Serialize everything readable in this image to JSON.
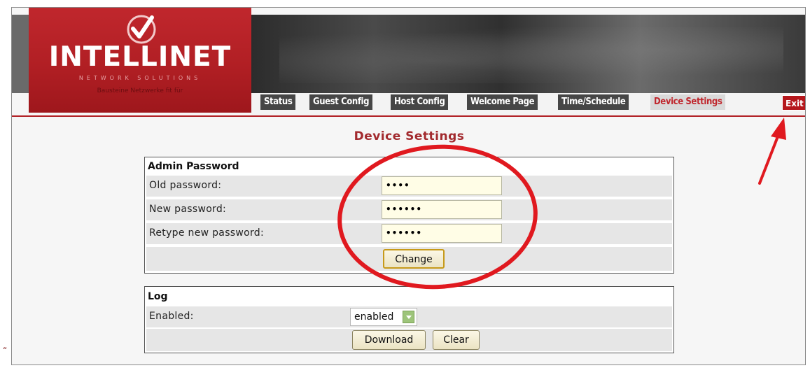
{
  "header": {
    "logo_text": "INTELLINET",
    "logo_subtitle": "NETWORK SOLUTIONS",
    "logo_tagline": "Bausteine Netzwerke fit für",
    "nav": [
      {
        "label": "Status",
        "active": false
      },
      {
        "label": "Guest Config",
        "active": false
      },
      {
        "label": "Host Config",
        "active": false
      },
      {
        "label": "Welcome Page",
        "active": false
      },
      {
        "label": "Time/Schedule",
        "active": false
      },
      {
        "label": "Device Settings",
        "active": true
      }
    ],
    "exit_label": "Exit"
  },
  "page": {
    "title": "Device Settings"
  },
  "admin_password": {
    "title": "Admin Password",
    "old_label": "Old password:",
    "old_value": "••••",
    "new_label": "New password:",
    "new_value": "••••••",
    "retype_label": "Retype new password:",
    "retype_value": "••••••",
    "change_label": "Change"
  },
  "log": {
    "title": "Log",
    "enabled_label": "Enabled:",
    "enabled_value": "enabled",
    "download_label": "Download",
    "clear_label": "Clear"
  },
  "stray_mark": "“",
  "colors": {
    "brand_red": "#c0272d",
    "nav_bg": "#464646",
    "annotation_red": "#e0191f"
  }
}
